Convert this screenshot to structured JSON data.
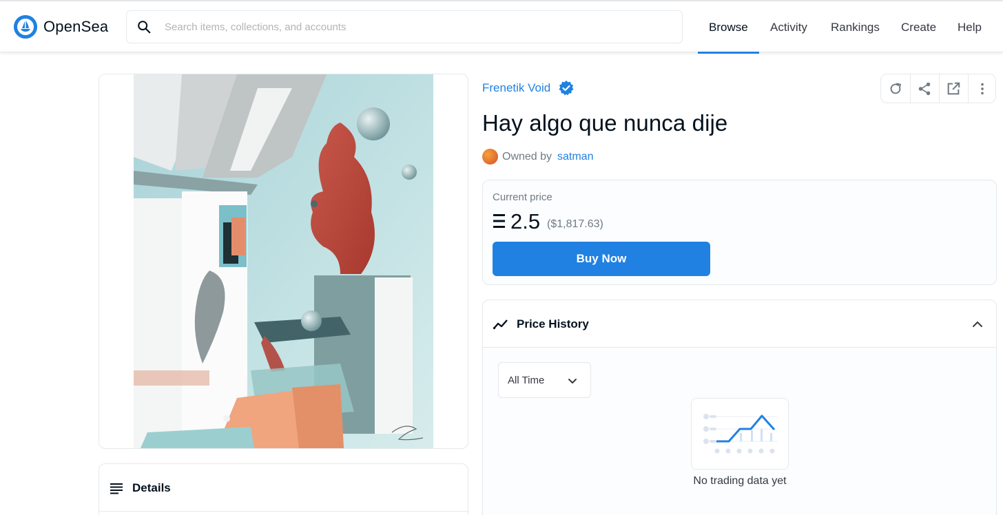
{
  "app": {
    "name": "OpenSea",
    "brand_color": "#2081e2"
  },
  "search": {
    "placeholder": "Search items, collections, and accounts"
  },
  "nav": {
    "browse": "Browse",
    "activity": "Activity",
    "rankings": "Rankings",
    "create": "Create",
    "help": "Help",
    "active": "Browse"
  },
  "item": {
    "collection": "Frenetik Void",
    "title": "Hay algo que nunca dije",
    "owned_by_label": "Owned by",
    "owner": "satman"
  },
  "actions": {
    "icons": [
      "refresh-icon",
      "share-icon",
      "external-link-icon",
      "more-icon"
    ]
  },
  "price": {
    "label": "Current price",
    "currency_icon": "eth-icon",
    "value": "2.5",
    "usd": "($1,817.63)",
    "buy_label": "Buy Now"
  },
  "details": {
    "title": "Details"
  },
  "price_history": {
    "title": "Price History",
    "range_selected": "All Time",
    "empty_text": "No trading data yet"
  }
}
